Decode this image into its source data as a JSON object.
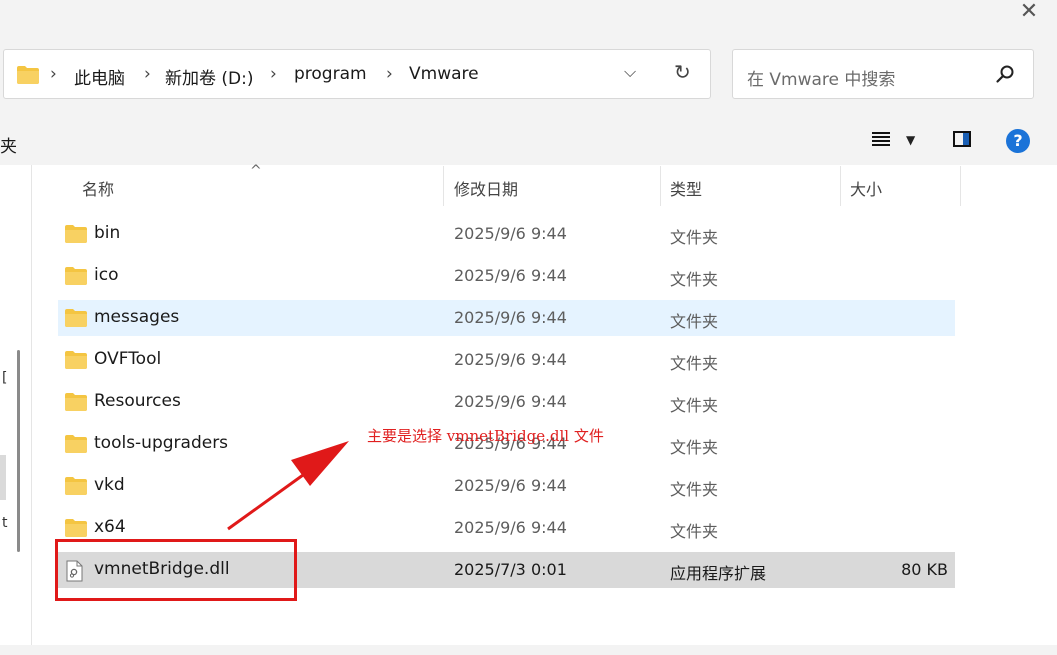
{
  "window": {
    "close_glyph": "✕"
  },
  "address": {
    "crumbs": [
      "此电脑",
      "新加卷 (D:)",
      "program",
      "Vmware"
    ],
    "separator": "›",
    "dropdown_glyph": "⌵",
    "refresh_glyph": "↻"
  },
  "search": {
    "placeholder": "在 Vmware 中搜索"
  },
  "command_bar": {
    "left_fragment": "夹"
  },
  "columns": {
    "name": "名称",
    "date": "修改日期",
    "type": "类型",
    "size": "大小"
  },
  "files": [
    {
      "name": "bin",
      "date": "2025/9/6 9:44",
      "type": "文件夹",
      "size": "",
      "icon": "folder-icon",
      "state": "normal"
    },
    {
      "name": "ico",
      "date": "2025/9/6 9:44",
      "type": "文件夹",
      "size": "",
      "icon": "folder-icon",
      "state": "normal"
    },
    {
      "name": "messages",
      "date": "2025/9/6 9:44",
      "type": "文件夹",
      "size": "",
      "icon": "folder-icon",
      "state": "hover"
    },
    {
      "name": "OVFTool",
      "date": "2025/9/6 9:44",
      "type": "文件夹",
      "size": "",
      "icon": "folder-icon",
      "state": "normal"
    },
    {
      "name": "Resources",
      "date": "2025/9/6 9:44",
      "type": "文件夹",
      "size": "",
      "icon": "folder-icon",
      "state": "normal"
    },
    {
      "name": "tools-upgraders",
      "date": "2025/9/6 9:44",
      "type": "文件夹",
      "size": "",
      "icon": "folder-icon",
      "state": "normal"
    },
    {
      "name": "vkd",
      "date": "2025/9/6 9:44",
      "type": "文件夹",
      "size": "",
      "icon": "folder-icon",
      "state": "normal"
    },
    {
      "name": "x64",
      "date": "2025/9/6 9:44",
      "type": "文件夹",
      "size": "",
      "icon": "folder-icon",
      "state": "normal"
    },
    {
      "name": "vmnetBridge.dll",
      "date": "2025/7/3 0:01",
      "type": "应用程序扩展",
      "size": "80 KB",
      "icon": "dll-file-icon",
      "state": "selected"
    }
  ],
  "annotation": {
    "text": "主要是选择 vmnetBridge.dll 文件",
    "color": "#e02020"
  },
  "nav_fragments": [
    "[",
    "t"
  ],
  "colors": {
    "folder": "#f4c542",
    "accent": "#1b73d8",
    "hover": "#e5f3ff",
    "selected": "#d9d9d9",
    "annotation": "#e01919"
  }
}
